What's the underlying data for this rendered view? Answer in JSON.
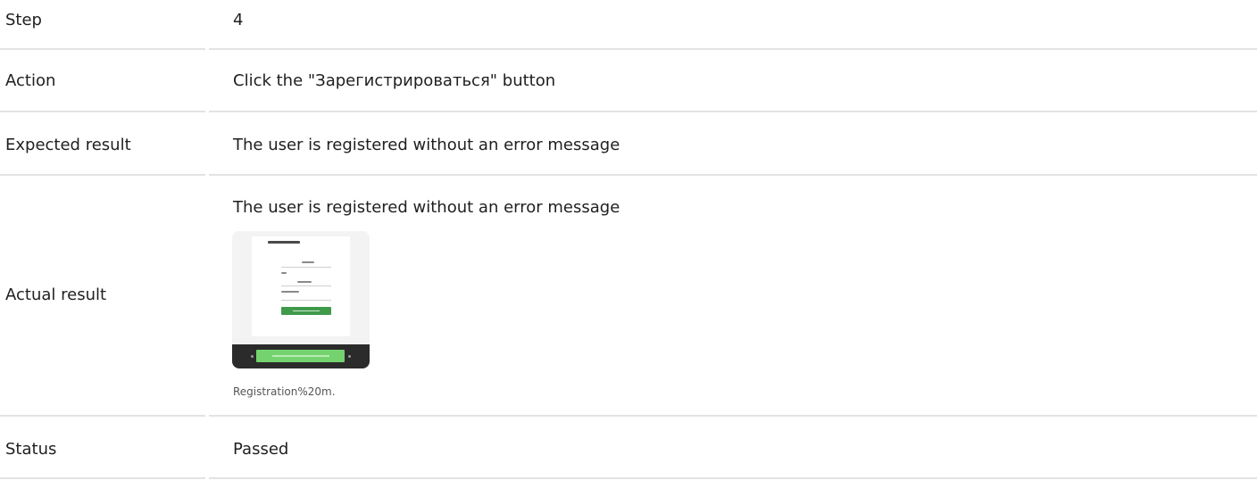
{
  "rows": {
    "step": {
      "label": "Step",
      "value": "4"
    },
    "action": {
      "label": "Action",
      "value": "Click the \"Зарегистрироваться\" button"
    },
    "expected": {
      "label": "Expected result",
      "value": "The user is registered without an error message"
    },
    "actual": {
      "label": "Actual result",
      "value": "The user is registered without an error message",
      "attachment_caption": "Registration%20m."
    },
    "status": {
      "label": "Status",
      "value": "Passed"
    }
  },
  "colors": {
    "divider": "#e3e3e3",
    "thumbnail_button": "#3f9a4a",
    "thumbnail_bar_button": "#74d36e"
  }
}
